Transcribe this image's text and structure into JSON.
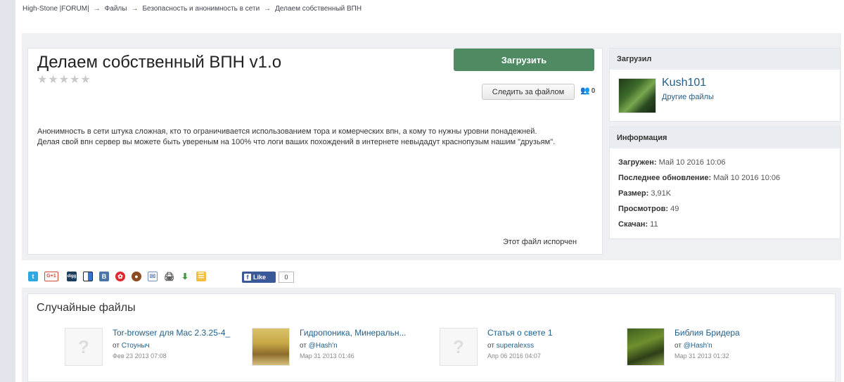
{
  "breadcrumb": {
    "items": [
      "High-Stone |FORUM|",
      "Файлы",
      "Безопасность и анонимность в сети",
      "Делаем собственный ВПН"
    ],
    "separator": "→"
  },
  "file": {
    "title": "Делаем собственный ВПН v1.o",
    "rating_stars": "★★★★★",
    "download_label": "Загрузить",
    "follow_label": "Следить за файлом",
    "followers_count": "0",
    "description": [
      "Анонимность в сети штука сложная, кто то ограничивается использованием тора и комерческих впн, а кому то нужны уровни понадежней.",
      "Делая свой впн сервер вы можете быть увереным на 100% что логи ваших похождений в интернете невыдадут краснопузым нашим \"друзьям\"."
    ],
    "broken_label": "Этот файл испорчен"
  },
  "uploader": {
    "header": "Загрузил",
    "name": "Kush101",
    "other_files": "Другие файлы"
  },
  "info": {
    "header": "Информация",
    "rows": [
      {
        "label": "Загружен:",
        "value": "Май 10 2016 10:06"
      },
      {
        "label": "Последнее обновление:",
        "value": "Май 10 2016 10:06"
      },
      {
        "label": "Размер:",
        "value": "3,91K"
      },
      {
        "label": "Просмотров:",
        "value": "49"
      },
      {
        "label": "Скачан:",
        "value": "11"
      }
    ]
  },
  "share": {
    "icons": [
      "twitter-icon",
      "google-plus-icon",
      "digg-icon",
      "delicious-icon",
      "vkontakte-icon",
      "bookmark-icon",
      "odnoklassniki-icon",
      "email-icon",
      "print-icon",
      "download-icon",
      "feed-icon"
    ],
    "google_plus": "G+1",
    "digg": "digg",
    "vk": "B",
    "fb_like": "Like",
    "fb_count": "0"
  },
  "random": {
    "title": "Случайные файлы",
    "items": [
      {
        "name": "Tor-browser для Mac 2.3.25-4_",
        "prefix": "от",
        "author": "Стоуныч",
        "date": "Фев 23 2013 07:08"
      },
      {
        "name": "Гидропоника, Минеральн...",
        "prefix": "от",
        "author": "@Hash'n",
        "date": "Мар 31 2013 01:46"
      },
      {
        "name": "Статья о свете 1",
        "prefix": "от",
        "author": "superalexss",
        "date": "Апр 06 2016 04:07"
      },
      {
        "name": "Библия Бридера",
        "prefix": "от",
        "author": "@Hash'n",
        "date": "Мар 31 2013 01:32"
      }
    ],
    "placeholder_glyph": "?"
  },
  "colors": {
    "download_button": "#4f8a63",
    "link": "#1f5f8b",
    "facebook": "#3b5998"
  }
}
